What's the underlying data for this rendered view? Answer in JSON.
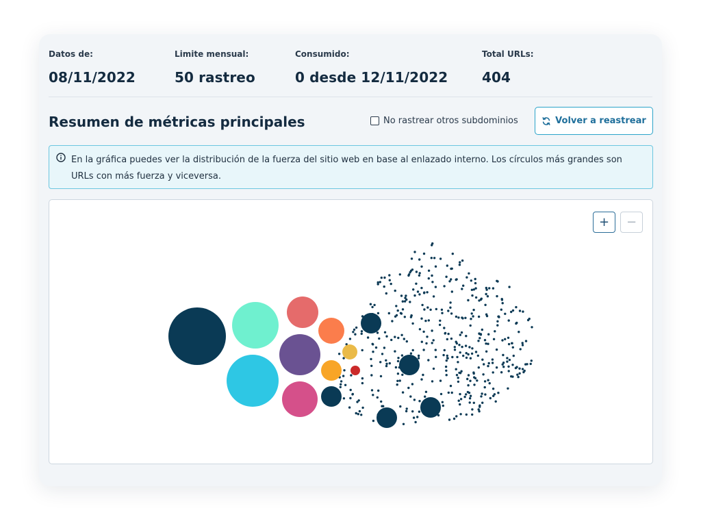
{
  "stats": [
    {
      "label": "Datos de:",
      "value": "08/11/2022"
    },
    {
      "label": "Limite mensual:",
      "value": "50 rastreo"
    },
    {
      "label": "Consumido:",
      "value": "0 desde 12/11/2022"
    },
    {
      "label": "Total URLs:",
      "value": "404"
    }
  ],
  "section": {
    "title": "Resumen de métricas principales"
  },
  "controls": {
    "checkbox_label": "No rastrear otros subdominios",
    "checkbox_checked": false,
    "recrawl_label": "Volver a reastrear"
  },
  "info": {
    "icon": "info-circle-icon",
    "text": "En la gráfica puedes ver la distribución de la fuerza del sitio web en base al enlazado interno. Los círculos más grandes son URLs con más fuerza y viceversa."
  },
  "zoom": {
    "in_label": "+",
    "out_label": "−"
  },
  "colors": {
    "navy": "#0a3a55",
    "mint": "#6ff0cf",
    "cyan": "#2ec7e4",
    "salmon": "#e56b6b",
    "orange": "#fb7d4c",
    "purple": "#6a5292",
    "yellow": "#eaba48",
    "amber": "#f8a527",
    "red": "#cb2a2a",
    "pink": "#d5508a",
    "dot": "#0d3a55",
    "accent": "#2aa3c9"
  }
}
